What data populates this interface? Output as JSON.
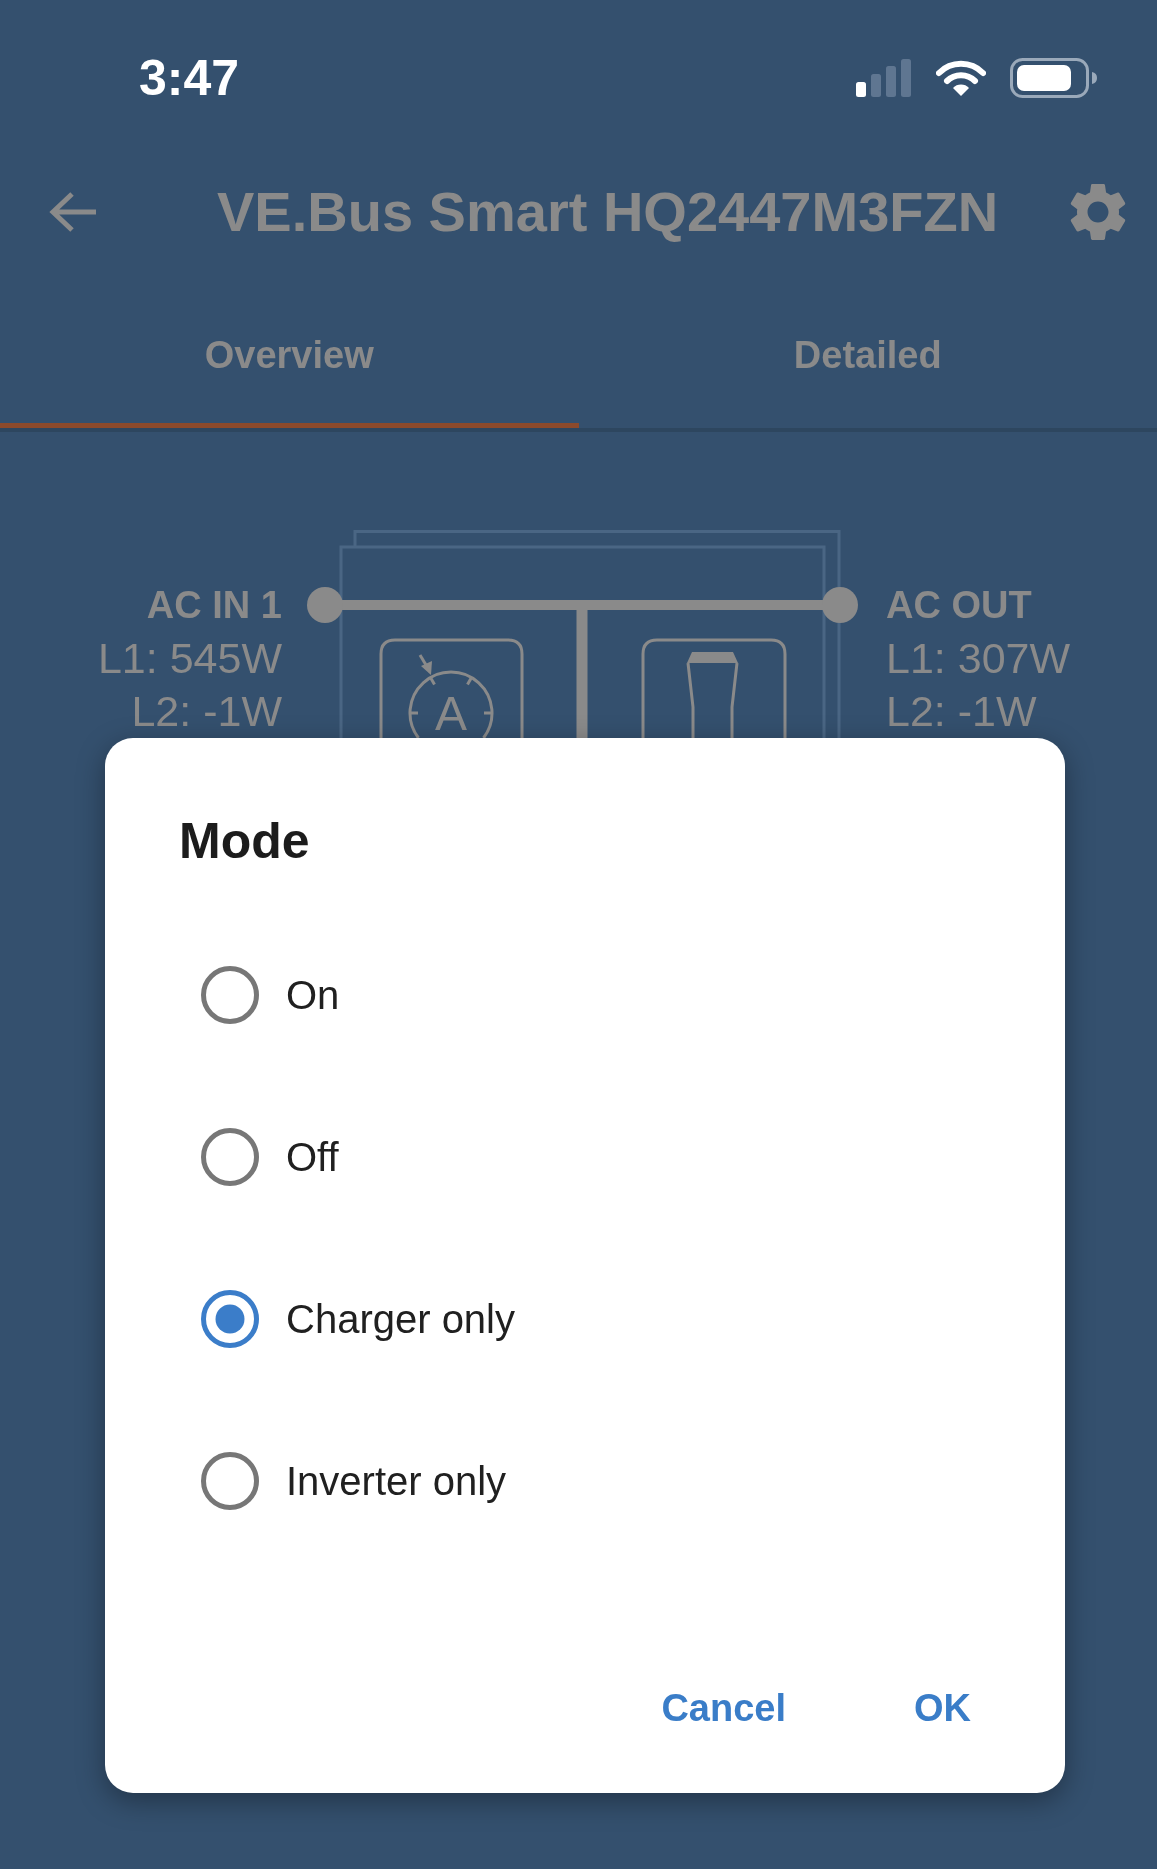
{
  "status_bar": {
    "time": "3:47"
  },
  "header": {
    "title": "VE.Bus Smart HQ2447M3FZN"
  },
  "tabs": [
    {
      "label": "Overview",
      "selected": true
    },
    {
      "label": "Detailed",
      "selected": false
    }
  ],
  "diagram": {
    "ac_in": {
      "label": "AC IN 1",
      "readings": [
        "L1: 545W",
        "L2: -1W"
      ]
    },
    "ac_out": {
      "label": "AC OUT",
      "readings": [
        "L1: 307W",
        "L2: -1W"
      ]
    },
    "gauge_letter": "A"
  },
  "dialog": {
    "title": "Mode",
    "options": [
      {
        "label": "On",
        "selected": false
      },
      {
        "label": "Off",
        "selected": false
      },
      {
        "label": "Charger only",
        "selected": true
      },
      {
        "label": "Inverter only",
        "selected": false
      }
    ],
    "buttons": [
      "Cancel",
      "OK"
    ]
  }
}
